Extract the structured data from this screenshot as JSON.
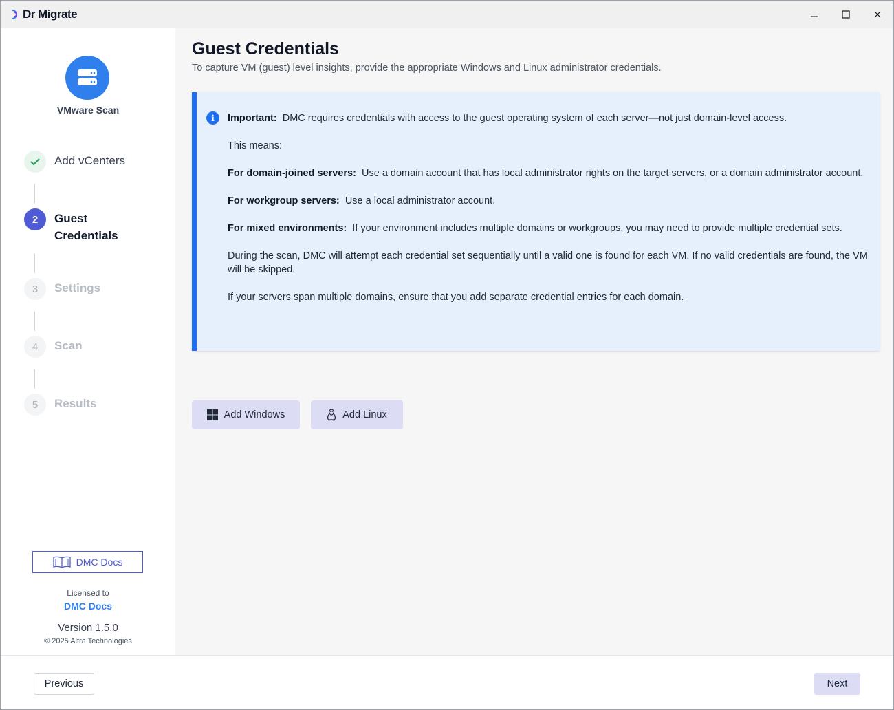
{
  "titlebar": {
    "app_name": "Dr Migrate",
    "minimize_glyph": "—",
    "maximize_glyph": "☐",
    "close_glyph": "✕"
  },
  "sidebar": {
    "scan_title": "VMware Scan",
    "steps": [
      {
        "number": "✓",
        "label": "Add vCenters",
        "state": "done"
      },
      {
        "number": "2",
        "label": "Guest Credentials",
        "state": "active"
      },
      {
        "number": "3",
        "label": "Settings",
        "state": "pending"
      },
      {
        "number": "4",
        "label": "Scan",
        "state": "pending"
      },
      {
        "number": "5",
        "label": "Results",
        "state": "pending"
      }
    ],
    "docs_button": "DMC Docs",
    "license_label": "Licensed to",
    "license_name": "DMC Docs",
    "version": "Version 1.5.0",
    "copyright": "© 2025 Altra Technologies"
  },
  "main": {
    "title": "Guest Credentials",
    "subtitle": "To capture VM (guest) level insights, provide the appropriate Windows and Linux administrator credentials.",
    "info": {
      "important_label": "Important:",
      "important_text": "DMC requires credentials with access to the guest operating system of each server—not just domain-level access.",
      "means": "This means:",
      "domain_label": "For domain-joined servers:",
      "domain_text": "Use a domain account that has local administrator rights on the target servers, or a domain administrator account.",
      "workgroup_label": "For workgroup servers:",
      "workgroup_text": "Use a local administrator account.",
      "mixed_label": "For mixed environments:",
      "mixed_text": "If your environment includes multiple domains or workgroups, you may need to provide multiple credential sets.",
      "scan_text": "During the scan, DMC will attempt each credential set sequentially until a valid one is found for each VM. If no valid credentials are found, the VM will be skipped.",
      "span_text": "If your servers span multiple domains, ensure that you add separate credential entries for each domain."
    },
    "add_windows": "Add Windows",
    "add_linux": "Add Linux"
  },
  "footer": {
    "previous": "Previous",
    "next": "Next"
  },
  "colors": {
    "accent": "#4f5bd5",
    "info_border": "#1e6ff0",
    "info_bg": "#e6f0fc",
    "scan_badge": "#2f80ed",
    "done_green": "#22a05a"
  }
}
